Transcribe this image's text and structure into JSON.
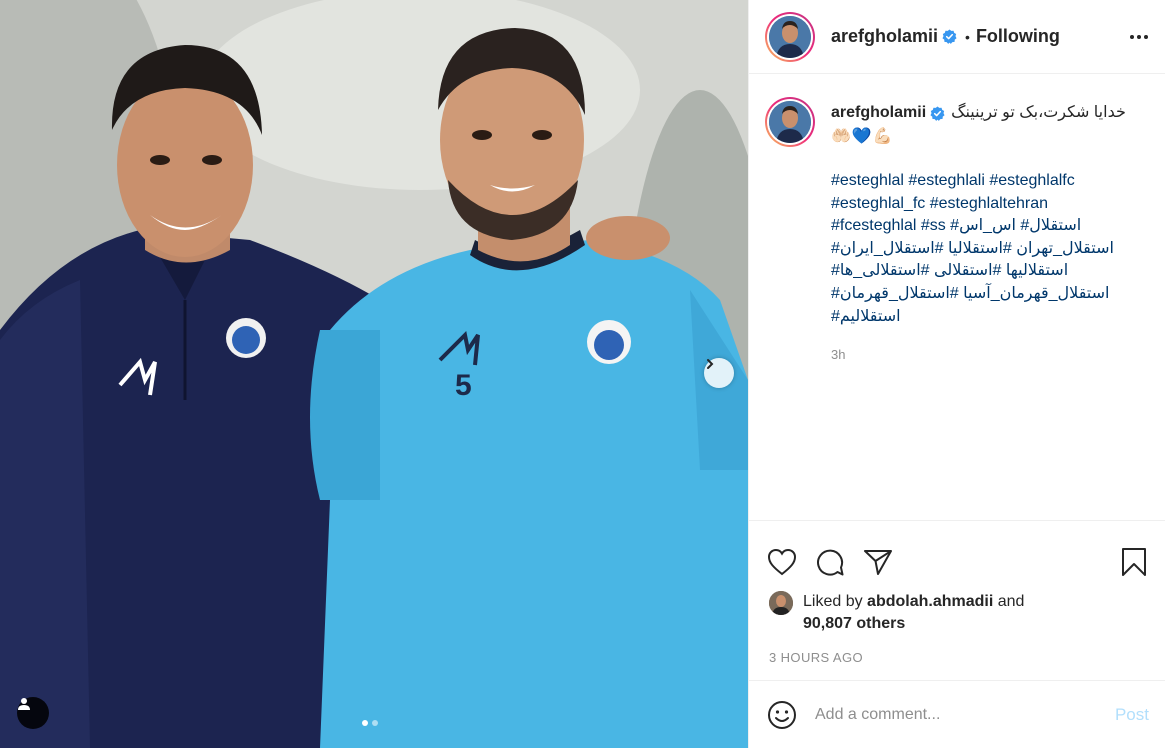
{
  "post": {
    "username": "arefgholamii",
    "separator": "•",
    "follow_status": "Following",
    "carousel": {
      "total_slides": 2,
      "active_slide": 1
    },
    "jersey_number": "5"
  },
  "caption": {
    "username": "arefgholamii",
    "text": "خدایا شکرت،بک تو ترینینگ",
    "emojis": "🤲🏻💙💪🏻",
    "hashtag_lines": [
      "#esteghlal #esteghlali #esteghlalfc",
      "#esteghlal_fc #esteghlaltehran",
      "#fcesteghlal #ss #استقلال# اس_اس",
      "#استقلال_تهران #استقلالیا #استقلال_ایران",
      "#استقلالیها #استقلالی #استقلالی_ها",
      "#استقلال_قهرمان_آسیا #استقلال_قهرمان",
      "#استقلالیم"
    ],
    "time": "3h"
  },
  "likes": {
    "prefix": "Liked by",
    "liker": "abdolah.ahmadii",
    "and": "and",
    "others": "90,807 others"
  },
  "timestamp": "3 HOURS AGO",
  "comment": {
    "placeholder": "Add a comment...",
    "post_label": "Post"
  },
  "icons": {
    "verified": "verified-badge-icon",
    "more": "more-options-icon",
    "like": "heart-icon",
    "comment": "comment-bubble-icon",
    "share": "paper-plane-icon",
    "save": "bookmark-icon",
    "emoji": "smiley-icon",
    "next": "chevron-right-icon",
    "tags": "user-tag-icon"
  },
  "colors": {
    "link": "#00376b",
    "verified": "#3897f0",
    "post_disabled": "#b2dffc",
    "muted": "#8e8e8e"
  }
}
